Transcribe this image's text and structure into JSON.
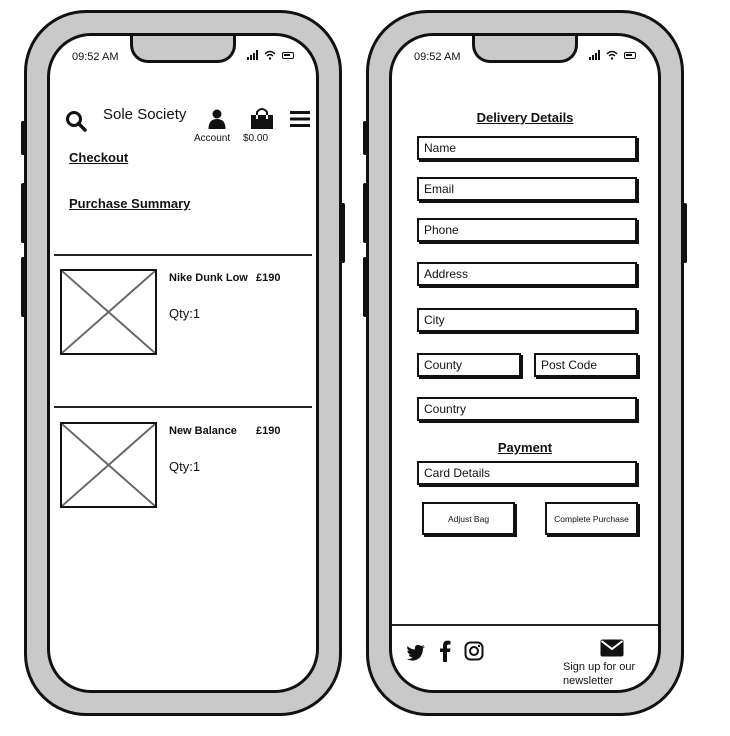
{
  "status_bar": {
    "time_left": "09:52 AM",
    "time_right": "09:52 AM"
  },
  "header": {
    "brand": "Sole Society",
    "account_label": "Account",
    "bag_total": "$0.00",
    "icons": [
      "search-icon",
      "account-icon",
      "bag-icon",
      "menu-icon"
    ]
  },
  "summary": {
    "checkout_label": "Checkout",
    "purchase_summary_label": "Purchase Summary",
    "items": [
      {
        "name": "Nike Dunk Low",
        "price": "£190",
        "qty": "Qty:1"
      },
      {
        "name": "New Balance",
        "price": "£190",
        "qty": "Qty:1"
      }
    ]
  },
  "delivery": {
    "title": "Delivery Details",
    "fields": {
      "name": "Name",
      "email": "Email",
      "phone": "Phone",
      "address": "Address",
      "city": "City",
      "county": "County",
      "postcode": "Post Code",
      "country": "Country"
    }
  },
  "payment": {
    "title": "Payment",
    "card": "Card Details"
  },
  "actions": {
    "adjust_bag": "Adjust Bag",
    "complete_purchase": "Complete Purchase"
  },
  "footer": {
    "social_icons": [
      "twitter-icon",
      "facebook-icon",
      "instagram-icon"
    ],
    "newsletter_line1": "Sign up for our",
    "newsletter_line2": "newsletter"
  }
}
